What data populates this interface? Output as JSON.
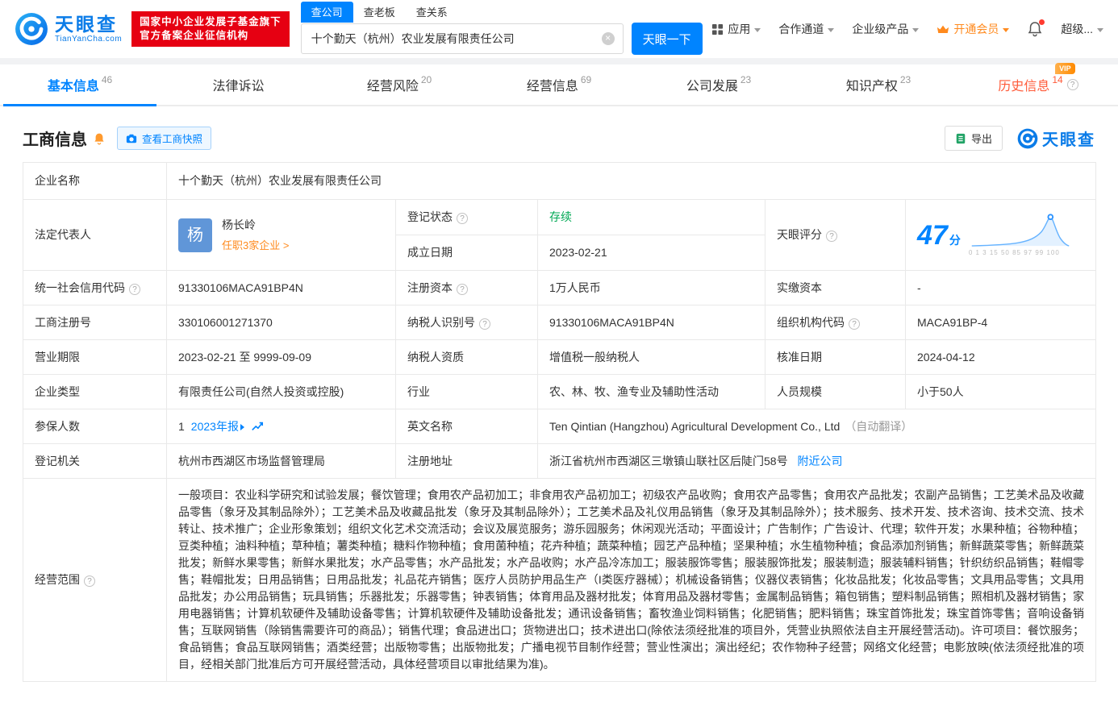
{
  "header": {
    "logo": {
      "name": "天眼查",
      "domain": "TianYanCha.com"
    },
    "badge": {
      "line1": "国家中小企业发展子基金旗下",
      "line2": "官方备案企业征信机构"
    },
    "search": {
      "tabs": [
        {
          "label": "查公司"
        },
        {
          "label": "查老板"
        },
        {
          "label": "查关系"
        }
      ],
      "value": "十个勤天（杭州）农业发展有限责任公司",
      "button": "天眼一下"
    },
    "menu": {
      "apps": "应用",
      "partner": "合作通道",
      "enterprise": "企业级产品",
      "vip": "开通会员",
      "super": "超级..."
    }
  },
  "nav": {
    "tabs": [
      {
        "label": "基本信息",
        "count": "46"
      },
      {
        "label": "法律诉讼",
        "count": ""
      },
      {
        "label": "经营风险",
        "count": "20"
      },
      {
        "label": "经营信息",
        "count": "69"
      },
      {
        "label": "公司发展",
        "count": "23"
      },
      {
        "label": "知识产权",
        "count": "23"
      },
      {
        "label": "历史信息",
        "count": "14",
        "vip_badge": "VIP"
      }
    ]
  },
  "section": {
    "title": "工商信息",
    "snapshot_button": "查看工商快照",
    "export_button": "导出",
    "brand": "天眼查"
  },
  "info": {
    "company_name": {
      "label": "企业名称",
      "value": "十个勤天（杭州）农业发展有限责任公司"
    },
    "legal_rep": {
      "label": "法定代表人",
      "avatar": "杨",
      "name": "杨长岭",
      "link": "任职3家企业 >"
    },
    "reg_status": {
      "label": "登记状态",
      "value": "存续"
    },
    "establish_date": {
      "label": "成立日期",
      "value": "2023-02-21"
    },
    "score": {
      "label": "天眼评分",
      "value": "47",
      "unit": "分",
      "axis": "0 1 3 15 50 85 97 99 100"
    },
    "credit_code": {
      "label": "统一社会信用代码",
      "value": "91330106MACA91BP4N"
    },
    "reg_capital": {
      "label": "注册资本",
      "value": "1万人民币"
    },
    "paid_capital": {
      "label": "实缴资本",
      "value": "-"
    },
    "reg_number": {
      "label": "工商注册号",
      "value": "330106001271370"
    },
    "taxpayer_id": {
      "label": "纳税人识别号",
      "value": "91330106MACA91BP4N"
    },
    "org_code": {
      "label": "组织机构代码",
      "value": "MACA91BP-4"
    },
    "business_term": {
      "label": "营业期限",
      "value": "2023-02-21 至 9999-09-09"
    },
    "taxpayer_quality": {
      "label": "纳税人资质",
      "value": "增值税一般纳税人"
    },
    "approval_date": {
      "label": "核准日期",
      "value": "2024-04-12"
    },
    "company_type": {
      "label": "企业类型",
      "value": "有限责任公司(自然人投资或控股)"
    },
    "industry": {
      "label": "行业",
      "value": "农、林、牧、渔专业及辅助性活动"
    },
    "staff_size": {
      "label": "人员规模",
      "value": "小于50人"
    },
    "insured": {
      "label": "参保人数",
      "value": "1",
      "report_link": "2023年报"
    },
    "english_name": {
      "label": "英文名称",
      "value": "Ten Qintian (Hangzhou) Agricultural Development Co., Ltd",
      "note": "（自动翻译）"
    },
    "reg_authority": {
      "label": "登记机关",
      "value": "杭州市西湖区市场监督管理局"
    },
    "reg_address": {
      "label": "注册地址",
      "value": "浙江省杭州市西湖区三墩镇山联社区后陡门58号",
      "link": "附近公司"
    },
    "business_scope": {
      "label": "经营范围",
      "value": "一般项目：农业科学研究和试验发展；餐饮管理；食用农产品初加工；非食用农产品初加工；初级农产品收购；食用农产品零售；食用农产品批发；农副产品销售；工艺美术品及收藏品零售（象牙及其制品除外）；工艺美术品及收藏品批发（象牙及其制品除外）；工艺美术品及礼仪用品销售（象牙及其制品除外）；技术服务、技术开发、技术咨询、技术交流、技术转让、技术推广；企业形象策划；组织文化艺术交流活动；会议及展览服务；游乐园服务；休闲观光活动；平面设计；广告制作；广告设计、代理；软件开发；水果种植；谷物种植；豆类种植；油料种植；草种植；薯类种植；糖料作物种植；食用菌种植；花卉种植；蔬菜种植；园艺产品种植；坚果种植；水生植物种植；食品添加剂销售；新鲜蔬菜零售；新鲜蔬菜批发；新鲜水果零售；新鲜水果批发；水产品零售；水产品批发；水产品收购；水产品冷冻加工；服装服饰零售；服装服饰批发；服装制造；服装辅料销售；针织纺织品销售；鞋帽零售；鞋帽批发；日用品销售；日用品批发；礼品花卉销售；医疗人员防护用品生产（I类医疗器械）；机械设备销售；仪器仪表销售；化妆品批发；化妆品零售；文具用品零售；文具用品批发；办公用品销售；玩具销售；乐器批发；乐器零售；钟表销售；体育用品及器材批发；体育用品及器材零售；金属制品销售；箱包销售；塑料制品销售；照相机及器材销售；家用电器销售；计算机软硬件及辅助设备零售；计算机软硬件及辅助设备批发；通讯设备销售；畜牧渔业饲料销售；化肥销售；肥料销售；珠宝首饰批发；珠宝首饰零售；音响设备销售；互联网销售（除销售需要许可的商品）；销售代理；食品进出口；货物进出口；技术进出口(除依法须经批准的项目外，凭营业执照依法自主开展经营活动)。许可项目：餐饮服务；食品销售；食品互联网销售；酒类经营；出版物零售；出版物批发；广播电视节目制作经营；营业性演出；演出经纪；农作物种子经营；网络文化经营；电影放映(依法须经批准的项目，经相关部门批准后方可开展经营活动，具体经营项目以审批结果为准)。"
    }
  }
}
